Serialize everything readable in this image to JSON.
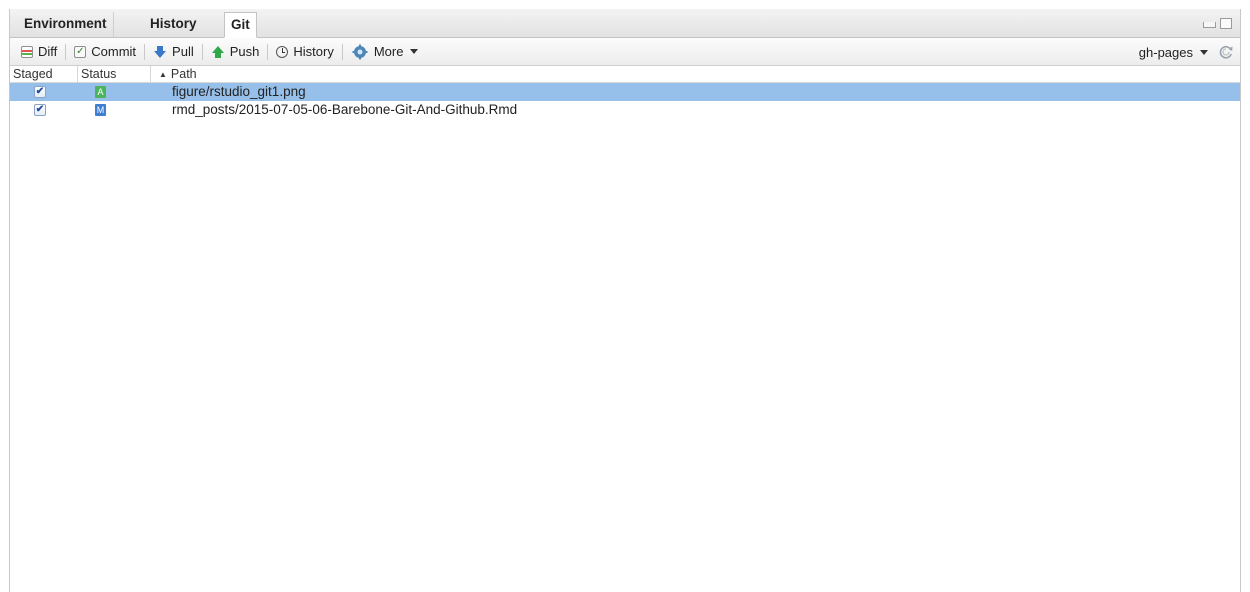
{
  "tabs": [
    {
      "label": "Environment"
    },
    {
      "label": "History"
    },
    {
      "label": "Git"
    }
  ],
  "toolbar": {
    "diff_label": "Diff",
    "commit_label": "Commit",
    "pull_label": "Pull",
    "push_label": "Push",
    "history_label": "History",
    "more_label": "More",
    "branch_label": "gh-pages"
  },
  "table": {
    "headers": {
      "staged": "Staged",
      "status": "Status",
      "path": "Path"
    },
    "rows": [
      {
        "staged": "✔",
        "status": "A",
        "status_color": "#4cb35e",
        "path": "figure/rstudio_git1.png",
        "selected": true
      },
      {
        "staged": "✔",
        "status": "M",
        "status_color": "#3f7fd1",
        "path": "rmd_posts/2015-07-05-06-Barebone-Git-And-Github.Rmd",
        "selected": false
      }
    ]
  },
  "colors": {
    "selection": "#96bfe9",
    "added": "#4cb35e",
    "modified": "#3f7fd1"
  }
}
